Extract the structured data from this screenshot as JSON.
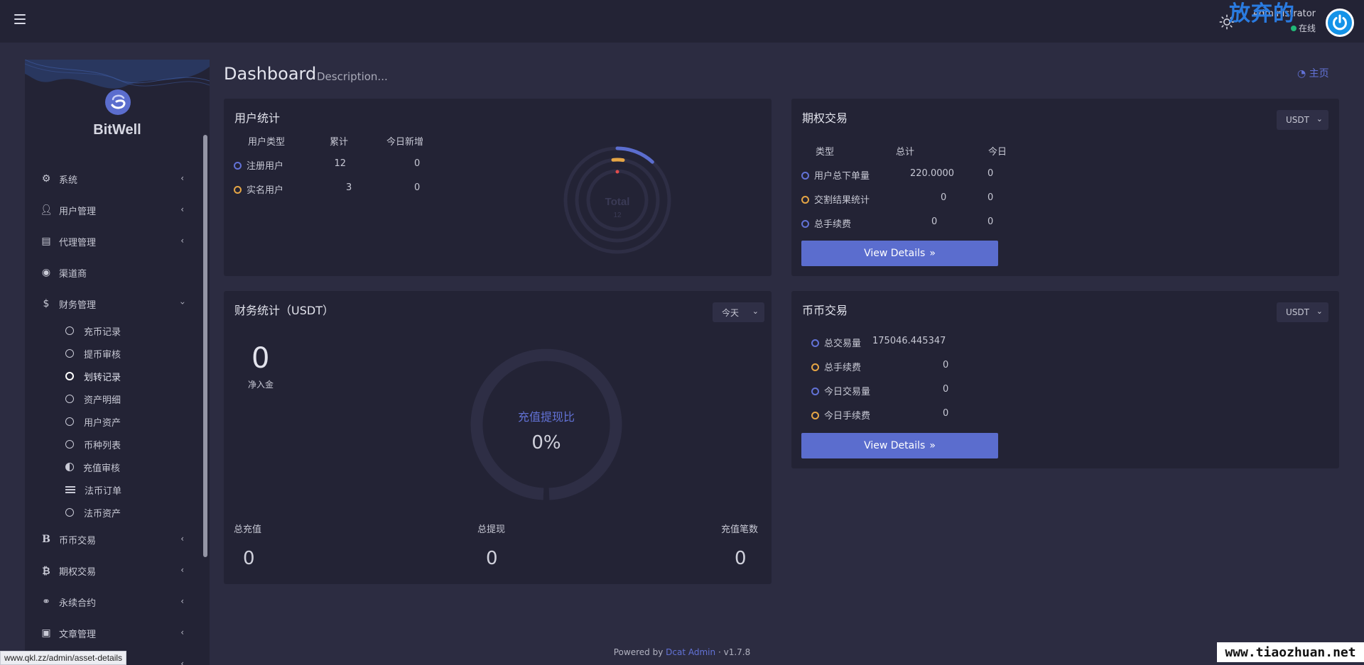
{
  "header": {
    "user_name": "Administrator",
    "user_status": "在线",
    "watermark": "放弃的"
  },
  "sidebar": {
    "logo": "BitWell",
    "items": [
      {
        "label": "系统",
        "icon": "gear-icon"
      },
      {
        "label": "用户管理",
        "icon": "user-icon"
      },
      {
        "label": "代理管理",
        "icon": "id-card-icon"
      },
      {
        "label": "渠道商",
        "icon": "user-circle-icon"
      },
      {
        "label": "财务管理",
        "icon": "dollar-icon"
      }
    ],
    "finance_sub": [
      "充币记录",
      "提币审核",
      "划转记录",
      "资产明细",
      "用户资产",
      "币种列表",
      "充值审核",
      "法币订单",
      "法币资产"
    ],
    "items_after": [
      {
        "label": "币币交易",
        "icon": "bold-b-icon"
      },
      {
        "label": "期权交易",
        "icon": "bitcoin-icon"
      },
      {
        "label": "永续合约",
        "icon": "link-icon"
      },
      {
        "label": "文章管理",
        "icon": "newspaper-icon"
      }
    ]
  },
  "page": {
    "title": "Dashboard",
    "description": "Description...",
    "home_link": "主页"
  },
  "user_stats": {
    "title": "用户统计",
    "headers": [
      "用户类型",
      "累计",
      "今日新增"
    ],
    "rows": [
      {
        "type": "注册用户",
        "total": "12",
        "today": "0"
      },
      {
        "type": "实名用户",
        "total": "3",
        "today": "0"
      }
    ],
    "chart_label": "Total",
    "chart_value": "12"
  },
  "options_trade": {
    "title": "期权交易",
    "select": "USDT",
    "headers": [
      "类型",
      "总计",
      "今日"
    ],
    "rows": [
      {
        "type": "用户总下单量",
        "total": "220.0000",
        "today": "0"
      },
      {
        "type": "交割结果统计",
        "total": "0",
        "today": "0"
      },
      {
        "type": "总手续费",
        "total": "0",
        "today": "0"
      }
    ],
    "button": "View Details"
  },
  "finance_stats": {
    "title": "财务统计（USDT）",
    "select": "今天",
    "net_value": "0",
    "net_label": "净入金",
    "ratio_label": "充值提现比",
    "ratio_value": "0%",
    "bottom": [
      {
        "label": "总充值",
        "value": "0"
      },
      {
        "label": "总提现",
        "value": "0"
      },
      {
        "label": "充值笔数",
        "value": "0"
      }
    ]
  },
  "coin_trade": {
    "title": "币币交易",
    "select": "USDT",
    "rows": [
      {
        "label": "总交易量",
        "value": "175046.445347"
      },
      {
        "label": "总手续费",
        "value": "0"
      },
      {
        "label": "今日交易量",
        "value": "0"
      },
      {
        "label": "今日手续费",
        "value": "0"
      }
    ],
    "button": "View Details"
  },
  "footer": {
    "powered": "Powered by",
    "brand": "Dcat Admin",
    "sep": "·",
    "version": "v1.7.8"
  },
  "status_url": "www.qkl.zz/admin/asset-details",
  "site_watermark": "www.tiaozhuan.net",
  "colors": {
    "accent": "#5b6dce",
    "yellow": "#e5a545",
    "online": "#21b978",
    "panel": "#232335",
    "bg": "#2c2c41"
  }
}
